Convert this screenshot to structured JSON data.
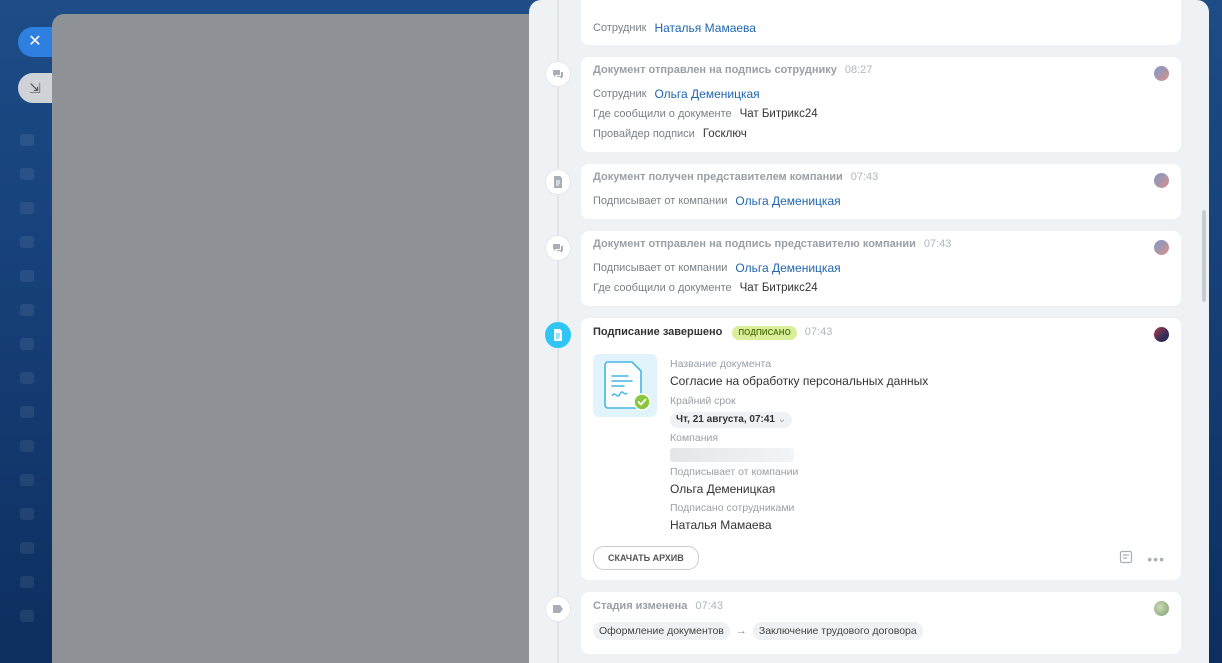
{
  "rail": {
    "close_icon": "close-icon",
    "minimize_icon": "minimize-icon"
  },
  "timeline": {
    "card0": {
      "label": "Сотрудник",
      "value": "Наталья Мамаева"
    },
    "card1": {
      "title": "Документ отправлен на подпись сотруднику",
      "time": "08:27",
      "rows": [
        {
          "label": "Сотрудник",
          "value": "Ольга Деменицкая"
        },
        {
          "label": "Где сообщили о документе",
          "value": "Чат Битрикс24"
        },
        {
          "label": "Провайдер подписи",
          "value": "Госключ"
        }
      ]
    },
    "card2": {
      "title": "Документ получен представителем компании",
      "time": "07:43",
      "rows": [
        {
          "label": "Подписывает от компании",
          "value": "Ольга Деменицкая"
        }
      ]
    },
    "card3": {
      "title": "Документ отправлен на подпись представителю компании",
      "time": "07:43",
      "rows": [
        {
          "label": "Подписывает от компании",
          "value": "Ольга Деменицкая"
        },
        {
          "label": "Где сообщили о документе",
          "value": "Чат Битрикс24"
        }
      ]
    },
    "card4": {
      "title": "Подписание завершено",
      "badge": "ПОДПИСАНО",
      "time": "07:43",
      "doc_label": "Название документа",
      "doc_value": "Согласие на обработку персональных данных",
      "deadline_label": "Крайний срок",
      "deadline_value": "Чт, 21 августа, 07:41",
      "company_label": "Компания",
      "signer_label": "Подписывает от компании",
      "signer_value": "Ольга Деменицкая",
      "employees_label": "Подписано сотрудниками",
      "employees_value": "Наталья Мамаева",
      "archive_button": "СКАЧАТЬ АРХИВ"
    },
    "card5": {
      "title": "Стадия изменена",
      "time": "07:43",
      "from": "Оформление документов",
      "arrow": "→",
      "to": "Заключение трудового договора"
    }
  },
  "colors": {
    "accent": "#2fc6f6",
    "link": "#2067b0",
    "badge_bg": "#d9ef9a"
  }
}
